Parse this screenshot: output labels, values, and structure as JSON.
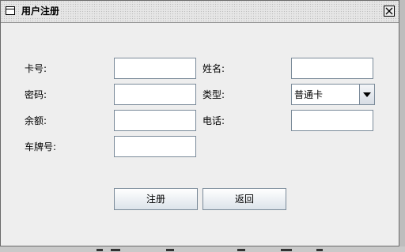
{
  "window": {
    "title": "用户注册"
  },
  "icons": {
    "window_icon": "window-icon",
    "close": "close-icon",
    "dropdown": "chevron-down-icon"
  },
  "form": {
    "card_no_label": "卡号:",
    "name_label": "姓名:",
    "password_label": "密码:",
    "type_label": "类型:",
    "balance_label": "余额:",
    "phone_label": "电话:",
    "plate_label": "车牌号:",
    "card_no_value": "",
    "name_value": "",
    "password_value": "",
    "balance_value": "",
    "phone_value": "",
    "plate_value": "",
    "type_selected": "普通卡"
  },
  "buttons": {
    "register": "注册",
    "back": "返回"
  }
}
